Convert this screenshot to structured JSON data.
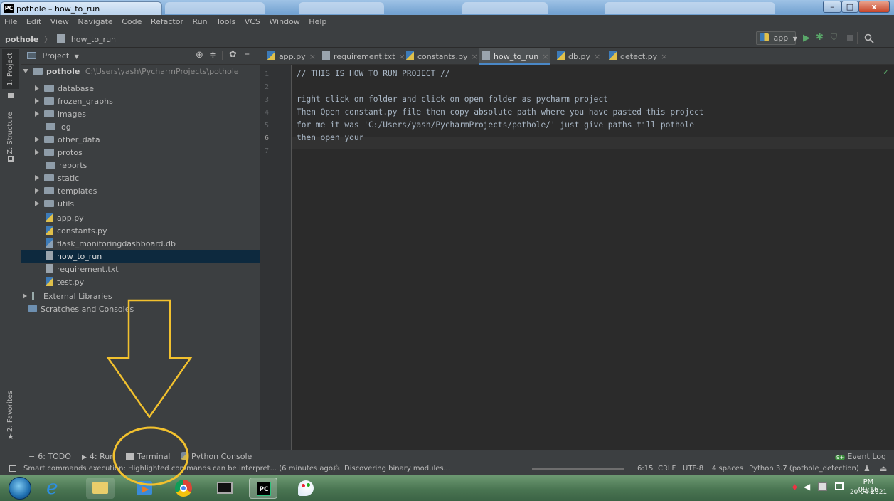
{
  "window": {
    "title": "pothole – how_to_run",
    "app_badge": "PC",
    "min": "–",
    "max": "□",
    "close": "x"
  },
  "menu": [
    "File",
    "Edit",
    "View",
    "Navigate",
    "Code",
    "Refactor",
    "Run",
    "Tools",
    "VCS",
    "Window",
    "Help"
  ],
  "breadcrumb": {
    "project": "pothole",
    "sep": "〉",
    "file": "how_to_run"
  },
  "run_config": "app",
  "side_tabs": {
    "project": "1: Project",
    "structure": "Z: Structure",
    "favorites": "2: Favorites"
  },
  "project_panel": {
    "title": "Project",
    "root": {
      "name": "pothole",
      "path": "C:\\Users\\yash\\PycharmProjects\\pothole"
    },
    "items": [
      {
        "label": "database",
        "type": "folder",
        "expandable": true
      },
      {
        "label": "frozen_graphs",
        "type": "folder",
        "expandable": true
      },
      {
        "label": "images",
        "type": "folder",
        "expandable": true
      },
      {
        "label": "log",
        "type": "folder",
        "expandable": false
      },
      {
        "label": "other_data",
        "type": "folder",
        "expandable": true
      },
      {
        "label": "protos",
        "type": "folder",
        "expandable": true
      },
      {
        "label": "reports",
        "type": "folder",
        "expandable": false
      },
      {
        "label": "static",
        "type": "folder",
        "expandable": true
      },
      {
        "label": "templates",
        "type": "folder",
        "expandable": true
      },
      {
        "label": "utils",
        "type": "folder",
        "expandable": true
      },
      {
        "label": "app.py",
        "type": "python"
      },
      {
        "label": "constants.py",
        "type": "python"
      },
      {
        "label": "flask_monitoringdashboard.db",
        "type": "db"
      },
      {
        "label": "how_to_run",
        "type": "text",
        "selected": true
      },
      {
        "label": "requirement.txt",
        "type": "text"
      },
      {
        "label": "test.py",
        "type": "python"
      }
    ],
    "external": "External Libraries",
    "scratches": "Scratches and Consoles"
  },
  "editor_tabs": [
    {
      "label": "app.py",
      "type": "python"
    },
    {
      "label": "requirement.txt",
      "type": "text"
    },
    {
      "label": "constants.py",
      "type": "python"
    },
    {
      "label": "how_to_run",
      "type": "text",
      "active": true
    },
    {
      "label": "db.py",
      "type": "python"
    },
    {
      "label": "detect.py",
      "type": "python"
    }
  ],
  "code_lines": [
    "// THIS IS HOW TO RUN PROJECT //",
    "",
    "right click on folder and click on open folder as pycharm project",
    "Then Open constant.py file then copy absolute path where you have pasted this project",
    "for me it was 'C:/Users/yash/PycharmProjects/pothole/' just give paths till pothole",
    "then open your",
    ""
  ],
  "line_numbers": [
    "1",
    "2",
    "3",
    "4",
    "5",
    "6",
    "7"
  ],
  "tool_windows": {
    "todo": "6: TODO",
    "run": "4: Run",
    "terminal": "Terminal",
    "python_console": "Python Console",
    "event_log": "Event Log",
    "event_badge": "9+"
  },
  "status": {
    "message": "Smart commands execution: Highlighted commands can be interpret... (6 minutes ago)",
    "progress_text": "Discovering binary modules...",
    "position": "6:15",
    "line_sep": "CRLF",
    "encoding": "UTF-8",
    "indent": "4 spaces",
    "interpreter": "Python 3.7 (pothole_detection)"
  },
  "taskbar": {
    "time": "PM 09:16",
    "date": "20-04-2021"
  },
  "colors": {
    "annotation": "#f2c12e",
    "selection": "#0d293e",
    "active_tab_underline": "#4a88c7"
  }
}
